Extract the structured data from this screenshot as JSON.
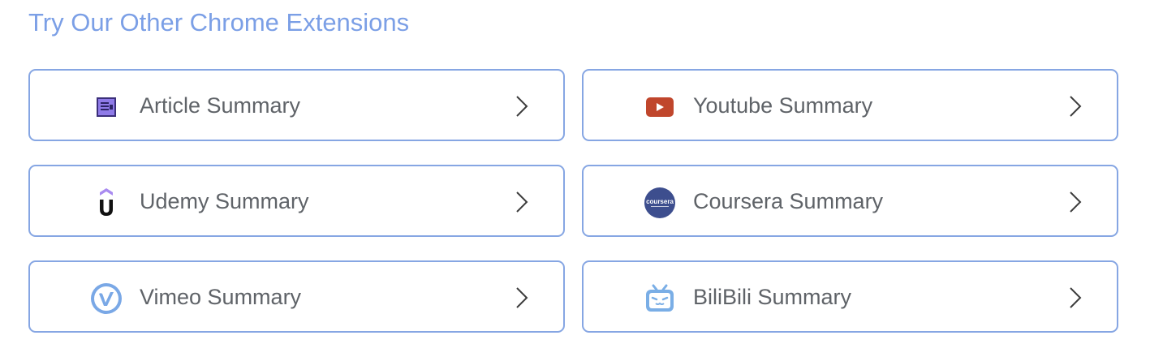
{
  "section": {
    "title": "Try Our Other Chrome Extensions"
  },
  "extensions": [
    {
      "label": "Article Summary",
      "icon": "article-icon"
    },
    {
      "label": "Youtube Summary",
      "icon": "youtube-icon"
    },
    {
      "label": "Udemy Summary",
      "icon": "udemy-icon"
    },
    {
      "label": "Coursera Summary",
      "icon": "coursera-icon",
      "icon_text": "coursera"
    },
    {
      "label": "Vimeo Summary",
      "icon": "vimeo-icon"
    },
    {
      "label": "BiliBili Summary",
      "icon": "bilibili-icon"
    }
  ],
  "colors": {
    "accent": "#7b9fe6",
    "card_border": "#86a6e3",
    "label_text": "#5f6368",
    "youtube_red": "#c0462c",
    "udemy_purple": "#a98bf0",
    "coursera_blue": "#3d4e8e",
    "vimeo_blue": "#7aa8e6",
    "bilibili_blue": "#7aaee6"
  }
}
